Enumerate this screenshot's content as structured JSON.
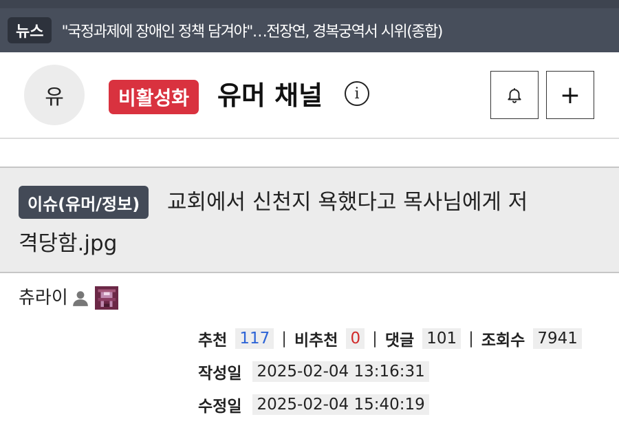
{
  "news": {
    "tag": "뉴스",
    "headline": "\"국정과제에 장애인 정책 담겨야\"…전장연, 경복궁역서 시위(종합)"
  },
  "channel": {
    "avatar_text": "유",
    "status_badge": "비활성화",
    "name": "유머 채널",
    "info_icon": "info-icon",
    "bell_icon": "bell-icon",
    "plus_label": "+"
  },
  "post": {
    "category": "이슈(유머/정보)",
    "title_line1": "교회에서 신천지 욕했다고 목사님에게 저",
    "title_line2": "격당함.jpg",
    "author": "츄라이",
    "stats": {
      "recommend_label": "추천",
      "recommend_value": "117",
      "not_recommend_label": "비추천",
      "not_recommend_value": "0",
      "comments_label": "댓글",
      "comments_value": "101",
      "views_label": "조회수",
      "views_value": "7941",
      "separator": "|"
    },
    "created_label": "작성일",
    "created_value": "2025-02-04 13:16:31",
    "modified_label": "수정일",
    "modified_value": "2025-02-04 15:40:19"
  },
  "colors": {
    "news_bar": "#474e5b",
    "status_badge": "#d9323f",
    "category_badge": "#434a57",
    "recommend": "#2d64d6",
    "not_recommend": "#d12a2a"
  }
}
